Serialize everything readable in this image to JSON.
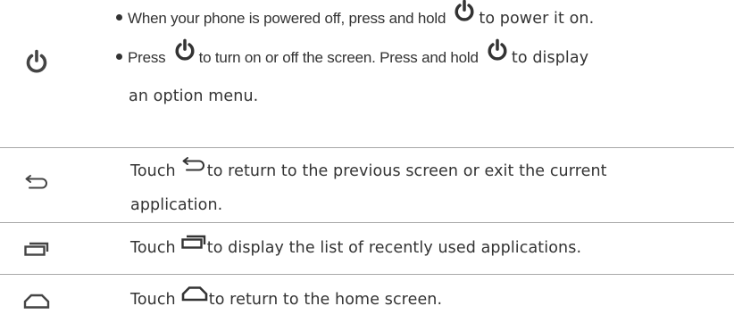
{
  "power_row": {
    "icon": "power-icon",
    "bullet1": {
      "text_before": "When your phone is powered off, press and hold",
      "text_after": "to power it on."
    },
    "bullet2": {
      "text_before": "Press",
      "text_middle": "to turn on or off the screen. Press and hold",
      "text_after": "to display",
      "text_line2": "an option menu."
    }
  },
  "back_row": {
    "icon": "back-icon",
    "text_before": "Touch",
    "text_after": "to return to the previous screen or exit the current",
    "text_line2": "application."
  },
  "recent_row": {
    "icon": "recent-apps-icon",
    "text_before": "Touch",
    "text_after": "to display the list of recently used applications."
  },
  "home_row": {
    "icon": "home-icon",
    "text_before": "Touch",
    "text_after": "to return to the home screen."
  },
  "colors": {
    "text": "#333333",
    "icon": "#444444",
    "divider": "#a8a8a8"
  }
}
